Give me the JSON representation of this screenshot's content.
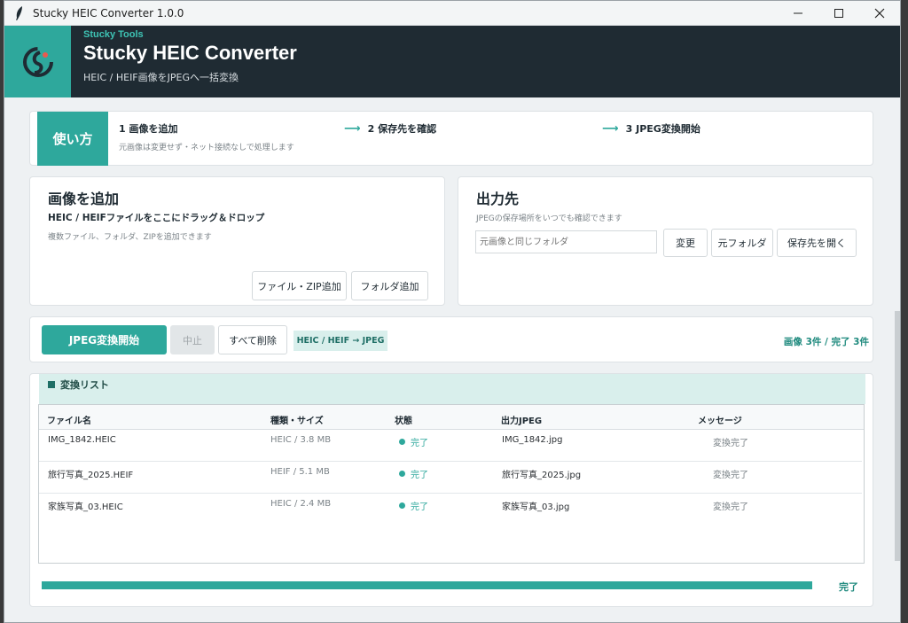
{
  "window": {
    "title": "Stucky HEIC Converter 1.0.0"
  },
  "header": {
    "brand": "Stucky Tools",
    "title": "Stucky HEIC Converter",
    "subtitle": "HEIC / HEIF画像をJPEGへ一括変換"
  },
  "usage": {
    "label": "使い方",
    "steps": [
      "1  画像を追加",
      "2  保存先を確認",
      "3  JPEG変換開始"
    ],
    "note": "元画像は変更せず・ネット接続なしで処理します"
  },
  "add": {
    "title": "画像を追加",
    "drop_text": "HEIC / HEIFファイルをここにドラッグ＆ドロップ",
    "hint": "複数ファイル、フォルダ、ZIPを追加できます",
    "btn_file": "ファイル・ZIP追加",
    "btn_folder": "フォルダ追加"
  },
  "output": {
    "title": "出力先",
    "hint": "JPEGの保存場所をいつでも確認できます",
    "placeholder": "元画像と同じフォルダ",
    "btn_change": "変更",
    "btn_original": "元フォルダ",
    "btn_open": "保存先を開く"
  },
  "actions": {
    "start": "JPEG変換開始",
    "stop": "中止",
    "clear": "すべて削除",
    "format": "HEIC / HEIF → JPEG",
    "counts": "画像 3件 / 完了 3件"
  },
  "list": {
    "title": "変換リスト",
    "columns": [
      "ファイル名",
      "種類・サイズ",
      "状態",
      "出力JPEG",
      "メッセージ"
    ],
    "rows": [
      {
        "name": "IMG_1842.HEIC",
        "type": "HEIC / 3.8 MB",
        "status": "完了",
        "output": "IMG_1842.jpg",
        "message": "変換完了"
      },
      {
        "name": "旅行写真_2025.HEIF",
        "type": "HEIF / 5.1 MB",
        "status": "完了",
        "output": "旅行写真_2025.jpg",
        "message": "変換完了"
      },
      {
        "name": "家族写真_03.HEIC",
        "type": "HEIC / 2.4 MB",
        "status": "完了",
        "output": "家族写真_03.jpg",
        "message": "変換完了"
      }
    ]
  },
  "progress": {
    "fraction": 1.0,
    "label": "完了"
  },
  "colors": {
    "accent": "#2ea89c",
    "header_bg": "#1f2b33",
    "badge_bg": "#d9efec"
  },
  "icons": {
    "app": "feather-icon",
    "logo": "stucky-logo-icon"
  }
}
